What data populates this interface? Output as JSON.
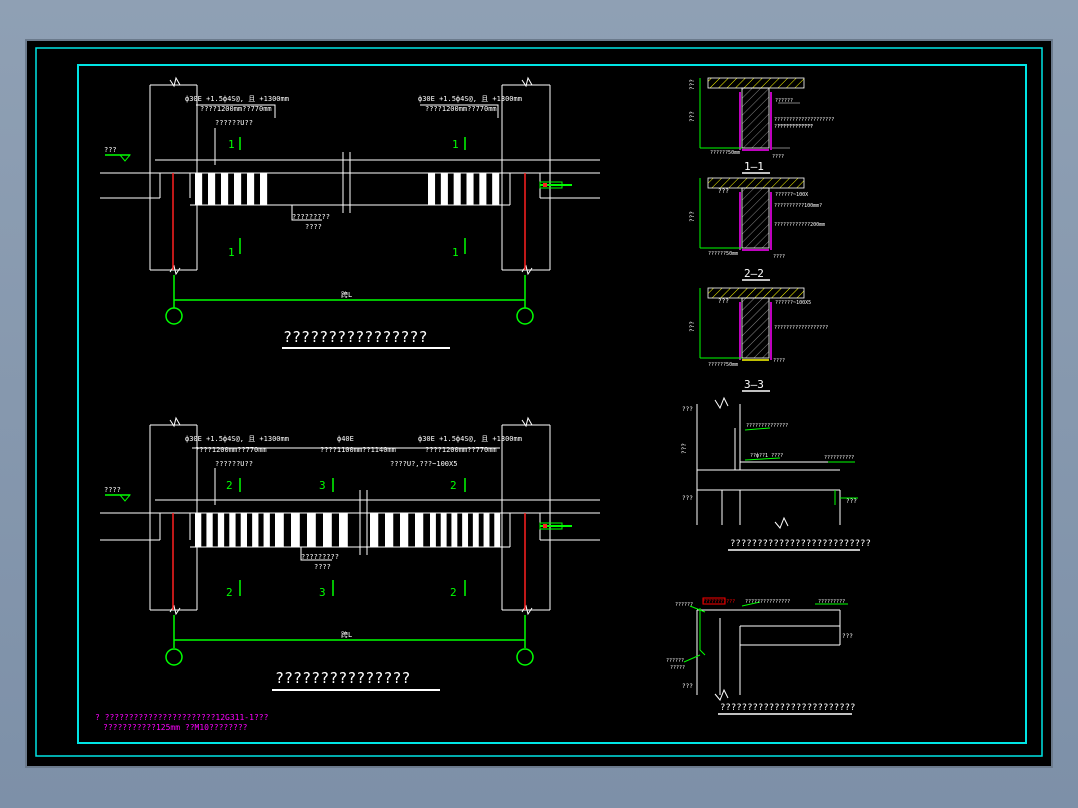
{
  "colors": {
    "bg_outer": "#8c9db2",
    "paper": "#000000",
    "frame": "#00e5e5",
    "lines": "#ffffff",
    "section_green": "#00ff00",
    "rebar_red": "#ff2020",
    "magenta": "#ff00ff",
    "yellow": "#ffff00",
    "annot_red": "#ff0000"
  },
  "plan_top": {
    "note_left_1": "ф30E +1.5ф4S@, 且 +1300mm",
    "note_left_2": "????1200mm??770mm",
    "note_left_3": "??????U??",
    "note_right_1": "ф30E +1.5ф4S@, 且 +1300mm",
    "note_right_2": "????1200mm??770mm",
    "wall_tag": "??? ",
    "mid_note_1": "?????????",
    "mid_note_2": "????",
    "sec_left_top": "1",
    "sec_left_bot": "1",
    "sec_right_top": "1",
    "sec_right_bot": "1",
    "span_label": "跨L",
    "title": "????????????????"
  },
  "plan_bottom": {
    "note_left_1": "ф30E +1.5ф4S@, 且 +1300mm",
    "note_left_2": "????1200mm??770mm",
    "note_left_3": "??????U??",
    "note_mid_1": "ф40E",
    "note_mid_2": "????1100mm??1140mm",
    "note_mid_3": "????U?,???~100X5",
    "note_right_1": "ф30E +1.5ф4S@, 且 +1300mm",
    "note_right_2": "????1200mm??770mm",
    "wall_tag": "????",
    "mid_note_1": "?????????",
    "mid_note_2": "????",
    "sec_a_top": "2",
    "sec_b_top": "3",
    "sec_c_top": "2",
    "sec_a_bot": "2",
    "sec_b_bot": "3",
    "sec_c_bot": "2",
    "span_label": "跨L",
    "title": "???????????????"
  },
  "footnote": {
    "line1": "? ???????????????????????12G311-1???",
    "line2": "???????????125mm ??M10????????"
  },
  "sections": {
    "s1_label": "1—1",
    "s2_label": "2—2",
    "s3_label": "3—3",
    "side_dim": "???",
    "top_tag": "???",
    "note_a": "??????",
    "note_b": "????????????????????",
    "note_c": "?????????????",
    "base_note_a": "??????50mm",
    "base_note_b": "????",
    "s2_note_a": "??????~100X",
    "s2_note_b": "??????????100mm?",
    "s2_note_c": "????????????200mm",
    "s3_note_a": "??????~100X5",
    "s3_note_b": "??????????????????"
  },
  "detail1": {
    "tag_a": "???",
    "tag_b": "???",
    "tag_c": "???",
    "note_top": "??????????????",
    "note_mid": "??ф??1 ????",
    "note_right": "??????????",
    "dim_right": "???",
    "title": "??????????????????????????"
  },
  "detail2": {
    "tag_a": "??????",
    "red_note": "???????????",
    "note_top": "???????????????",
    "note_right": "?????????",
    "note_left": "??????",
    "note_left2": "?????",
    "dim_right": "???",
    "dim_left": "???",
    "title": "?????????????????????????"
  }
}
